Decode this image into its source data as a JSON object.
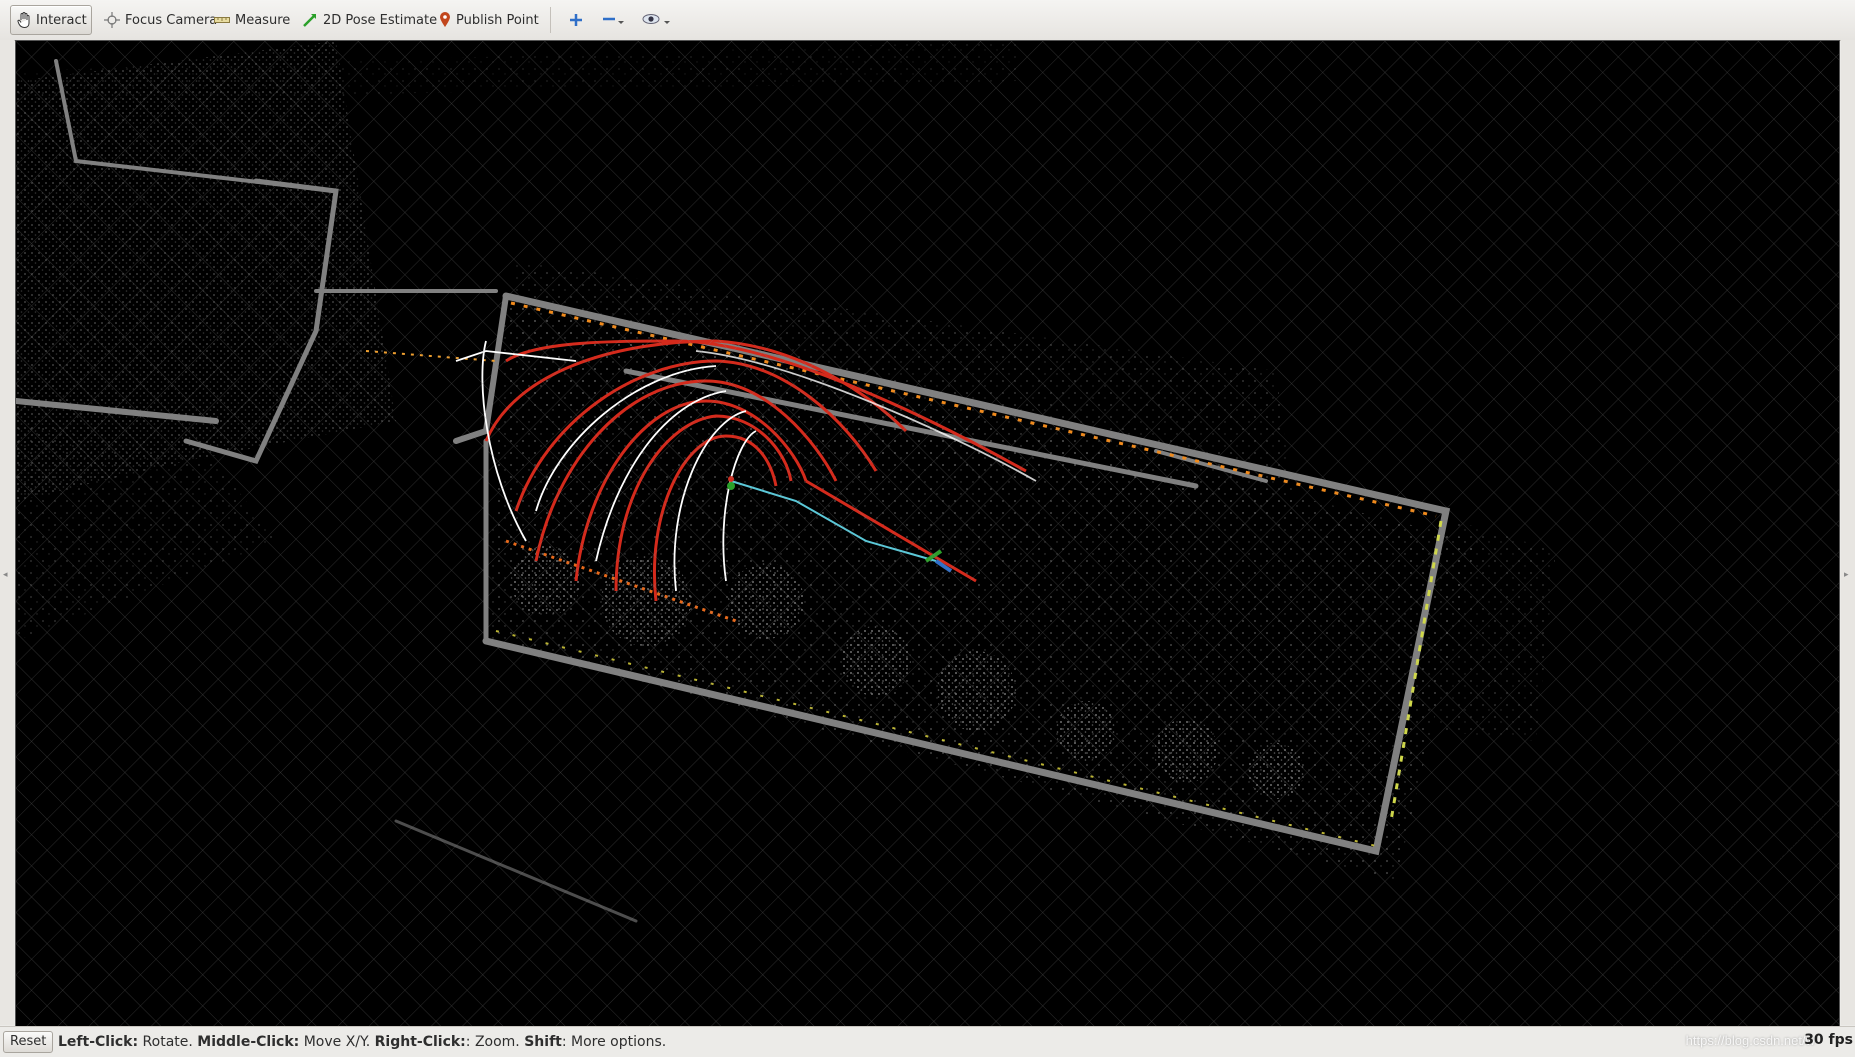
{
  "toolbar": {
    "interact": "Interact",
    "focus_camera": "Focus Camera",
    "measure": "Measure",
    "pose_estimate": "2D Pose Estimate",
    "publish_point": "Publish Point"
  },
  "icons": {
    "interact": "hand-pointer-icon",
    "focus_camera": "crosshair-icon",
    "measure": "ruler-icon",
    "pose_estimate": "green-arrow-icon",
    "publish_point": "map-pin-icon",
    "add_tool": "plus-icon",
    "remove_tool": "minus-icon",
    "view": "eye-icon"
  },
  "colors": {
    "point_cloud": "#7a7a7a",
    "trajectory": "#d42a1c",
    "scan_line": "#ffffff",
    "path": "#5bc8d8",
    "grid": "#8a8a8a",
    "accent_orange": "#f08a1c",
    "accent_yellow": "#e8e040"
  },
  "status": {
    "reset_label": "Reset",
    "left_click_key": "Left-Click:",
    "left_click_desc": " Rotate. ",
    "middle_click_key": "Middle-Click:",
    "middle_click_desc": " Move X/Y. ",
    "right_click_key": "Right-Click:",
    "right_click_desc": ": Zoom. ",
    "shift_key": "Shift",
    "shift_desc": ": More options.",
    "fps": "30 fps",
    "watermark": "https://blog.csdn.net/w"
  }
}
